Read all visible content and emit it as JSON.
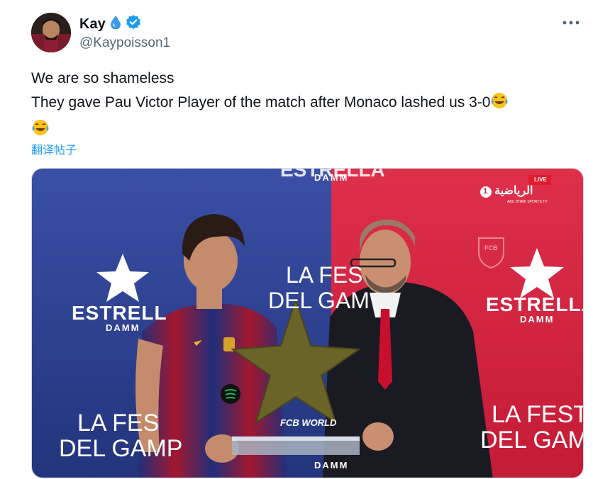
{
  "author": {
    "display_name": "Kay",
    "handle": "@Kaypoisson1",
    "verified": true,
    "name_emoji": "droplet-icon"
  },
  "tweet": {
    "line1": "We are so shameless",
    "line2": "They gave Pau Victor Player of the match after Monaco lashed us 3-0",
    "emoji": "face-with-tears-of-joy"
  },
  "translate_label": "翻译帖子",
  "media": {
    "top_brand": "ESTRELLA",
    "top_damm": "DAMM",
    "left_brand": "ESTRELL",
    "left_damm": "DAMM",
    "left_la_festa": "LA FES",
    "left_del_gamper": "DEL GAMP",
    "center_la_festa": "LA FES",
    "center_del_gamper": "DEL GAM",
    "right_brand": "ESTRELLA",
    "right_damm": "DAMM",
    "right_la_festa": "LA FESTA",
    "right_del_gamper": "DEL GAMPE",
    "fcb_world": "FCB WORLD",
    "bottom_damm": "DAMM",
    "broadcaster_live": "LIVE",
    "broadcaster_name": "الرياضية",
    "broadcaster_number": "1",
    "broadcaster_sub": "ABU DHABI SPORTS TV",
    "crest_text": "FCB",
    "colors": {
      "blue": "#2c3f8f",
      "red": "#d2243f",
      "trophy": "#6b6428"
    }
  }
}
